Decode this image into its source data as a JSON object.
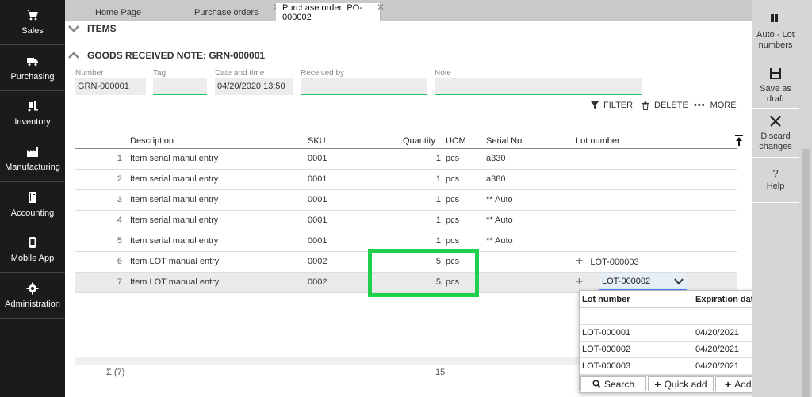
{
  "sidebar": {
    "items": [
      {
        "label": "Sales",
        "icon": "cart-icon"
      },
      {
        "label": "Purchasing",
        "icon": "truck-icon"
      },
      {
        "label": "Inventory",
        "icon": "forklift-icon"
      },
      {
        "label": "Manufacturing",
        "icon": "factory-icon"
      },
      {
        "label": "Accounting",
        "icon": "ledger-icon"
      },
      {
        "label": "Mobile App",
        "icon": "phone-icon"
      },
      {
        "label": "Administration",
        "icon": "gear-icon"
      }
    ]
  },
  "tabs": [
    {
      "label": "Home Page",
      "active": false
    },
    {
      "label": "Purchase orders",
      "active": false
    },
    {
      "label": "Purchase order: PO-000002",
      "active": true
    }
  ],
  "sections": {
    "items": "ITEMS",
    "grn": "GOODS RECEIVED NOTE: GRN-000001"
  },
  "form": {
    "number_label": "Number",
    "number_value": "GRN-000001",
    "tag_label": "Tag",
    "tag_value": "",
    "date_label": "Date and time",
    "date_value": "04/20/2020 13:50",
    "received_label": "Received by",
    "received_value": "",
    "note_label": "Note",
    "note_value": ""
  },
  "toolbar": {
    "filter": "FILTER",
    "delete": "DELETE",
    "more": "MORE"
  },
  "table": {
    "headers": {
      "description": "Description",
      "sku": "SKU",
      "quantity": "Quantity",
      "uom": "UOM",
      "serial": "Serial No.",
      "lot": "Lot number"
    },
    "rows": [
      {
        "n": "1",
        "desc": "Item serial manul entry",
        "sku": "0001",
        "qty": "1",
        "uom": "pcs",
        "serial": "a330",
        "lot": ""
      },
      {
        "n": "2",
        "desc": "Item serial manul entry",
        "sku": "0001",
        "qty": "1",
        "uom": "pcs",
        "serial": "a380",
        "lot": ""
      },
      {
        "n": "3",
        "desc": "Item serial manul entry",
        "sku": "0001",
        "qty": "1",
        "uom": "pcs",
        "serial": "** Auto",
        "lot": ""
      },
      {
        "n": "4",
        "desc": "Item serial manul entry",
        "sku": "0001",
        "qty": "1",
        "uom": "pcs",
        "serial": "** Auto",
        "lot": ""
      },
      {
        "n": "5",
        "desc": "Item serial manul entry",
        "sku": "0001",
        "qty": "1",
        "uom": "pcs",
        "serial": "** Auto",
        "lot": ""
      },
      {
        "n": "6",
        "desc": "Item LOT manual entry",
        "sku": "0002",
        "qty": "5",
        "uom": "pcs",
        "serial": "",
        "lot": "LOT-000003"
      },
      {
        "n": "7",
        "desc": "Item LOT manual entry",
        "sku": "0002",
        "qty": "5",
        "uom": "pcs",
        "serial": "",
        "lot": "LOT-000002"
      }
    ],
    "footer_count": "Σ (7)",
    "footer_qty": "15"
  },
  "dropdown": {
    "header_lot": "Lot number",
    "header_exp": "Expiration date",
    "rows": [
      {
        "lot": "LOT-000001",
        "exp": "04/20/2021"
      },
      {
        "lot": "LOT-000002",
        "exp": "04/20/2021"
      },
      {
        "lot": "LOT-000003",
        "exp": "04/20/2021"
      }
    ],
    "search": "Search",
    "quick_add": "Quick add",
    "add_new": "Add new"
  },
  "right_panel": {
    "auto_lot": "Auto - Lot numbers",
    "save_draft": "Save as draft",
    "discard": "Discard changes",
    "help": "Help"
  }
}
